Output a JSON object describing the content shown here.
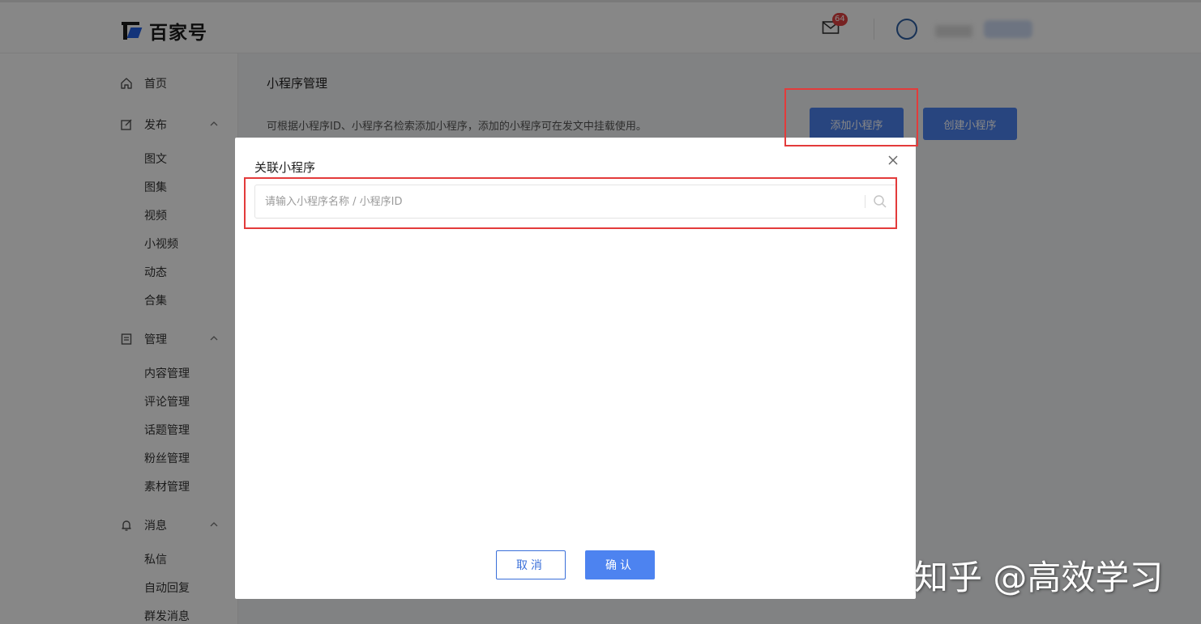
{
  "header": {
    "logo_text": "百家号",
    "mail_badge_count": "64",
    "mail_icon": "mail-icon",
    "avatar_icon": "avatar"
  },
  "sidebar": {
    "home": {
      "label": "首页",
      "icon": "home-icon"
    },
    "sections": [
      {
        "label": "发布",
        "icon": "edit-icon",
        "items": [
          "图文",
          "图集",
          "视频",
          "小视频",
          "动态",
          "合集"
        ]
      },
      {
        "label": "管理",
        "icon": "document-icon",
        "items": [
          "内容管理",
          "评论管理",
          "话题管理",
          "粉丝管理",
          "素材管理"
        ]
      },
      {
        "label": "消息",
        "icon": "bell-icon",
        "items": [
          "私信",
          "自动回复",
          "群发消息"
        ]
      }
    ]
  },
  "main": {
    "title": "小程序管理",
    "description": "可根据小程序ID、小程序名检索添加小程序，添加的小程序可在发文中挂载使用。",
    "add_button": "添加小程序",
    "create_button": "创建小程序"
  },
  "modal": {
    "title": "关联小程序",
    "search_placeholder": "请输入小程序名称 / 小程序ID",
    "search_value": "",
    "cancel_button": "取消",
    "confirm_button": "确认"
  },
  "watermark": "知乎 @高效学习",
  "colors": {
    "accent": "#4d83f0",
    "highlight": "#e33b3b",
    "badge": "#e04040"
  }
}
